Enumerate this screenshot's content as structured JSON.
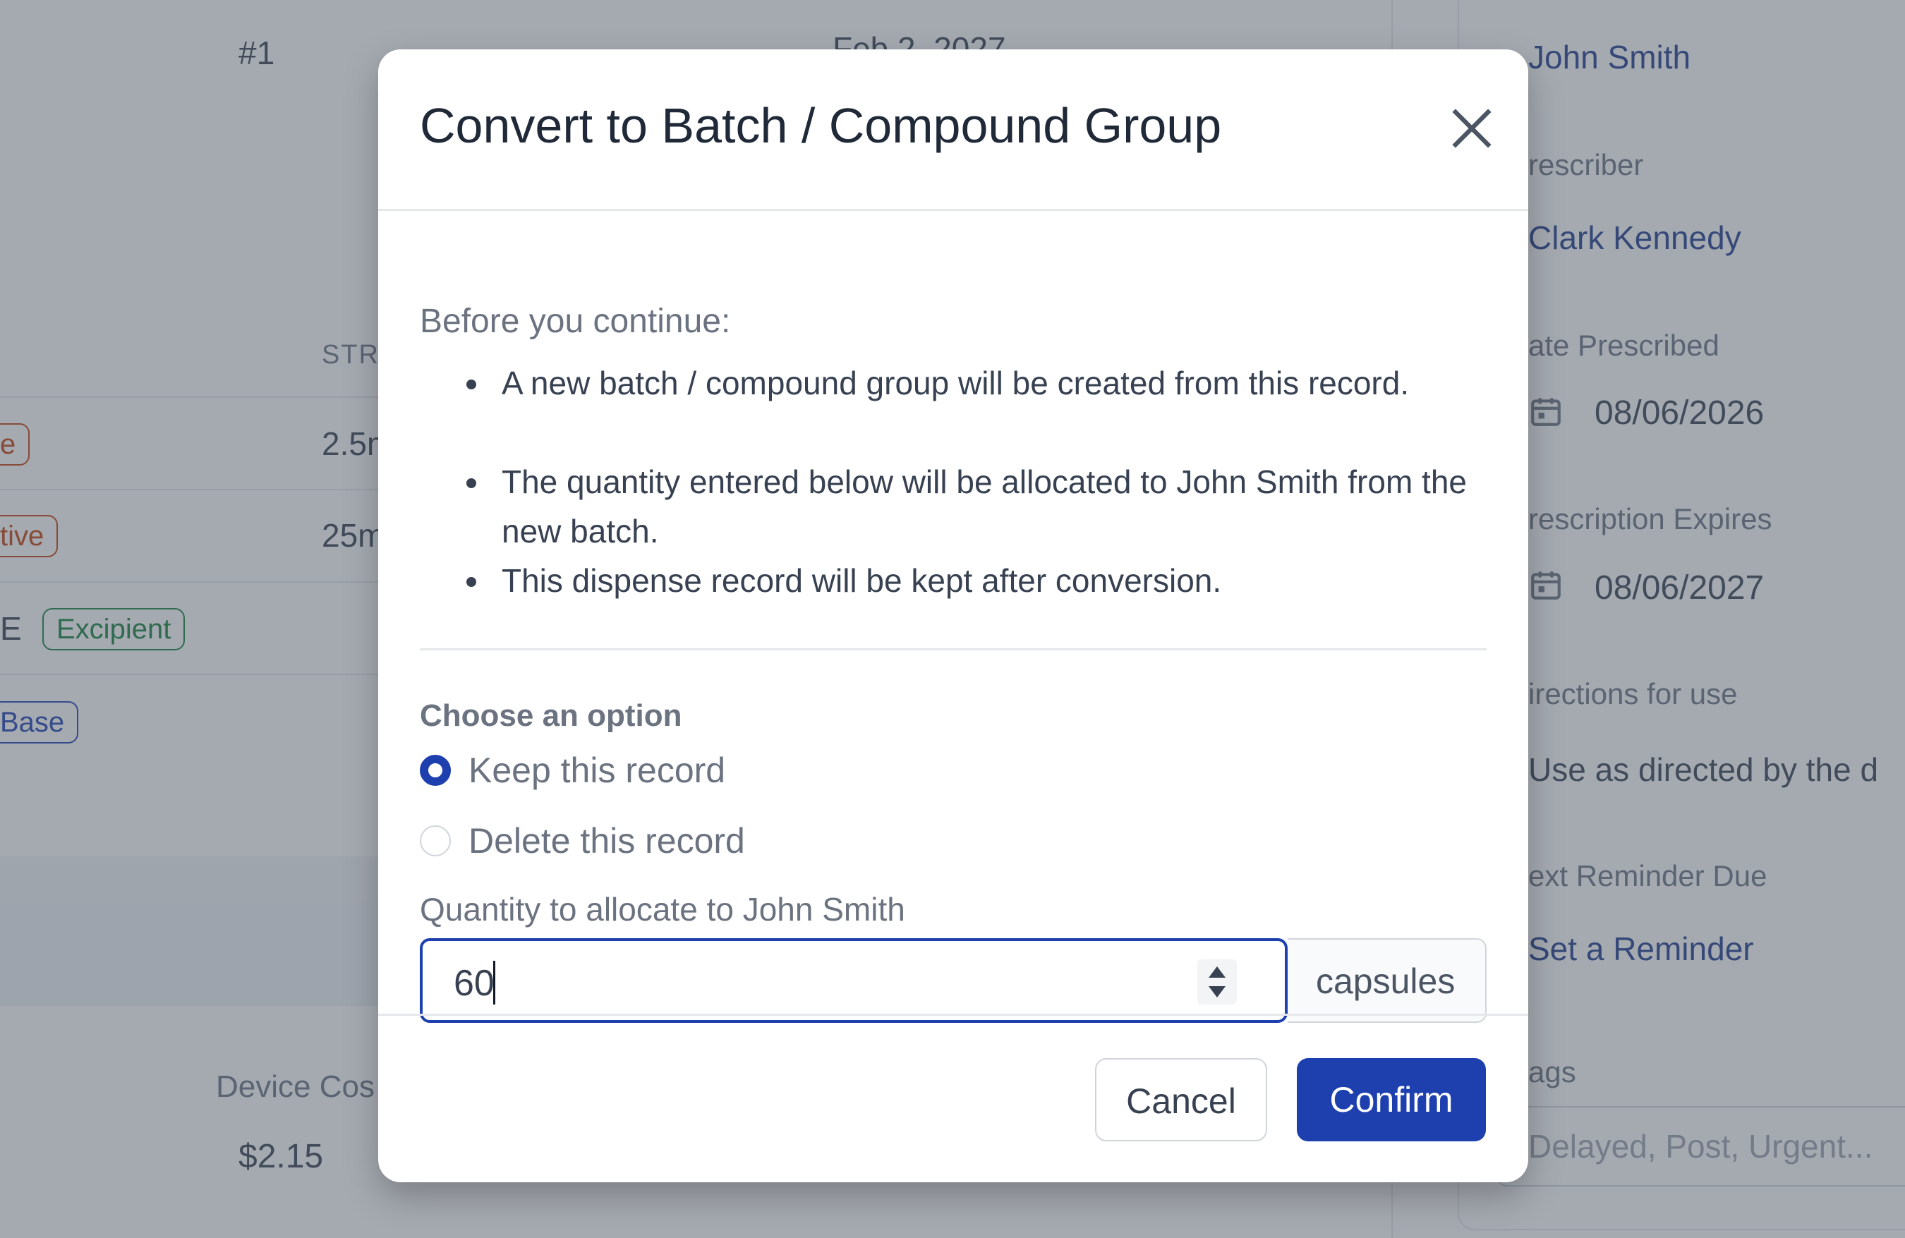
{
  "background": {
    "row_number": "#1",
    "date_partial": "Feb 2, 2027",
    "strength_header": "STR",
    "strength_values": [
      "2.5m",
      "25m"
    ],
    "ingredient_tail": "E",
    "badges": [
      {
        "label": "e",
        "color": "#c2410c"
      },
      {
        "label": "tive",
        "color": "#c2410c"
      },
      {
        "label": "Excipient",
        "color": "#15803d"
      },
      {
        "label": "Base",
        "color": "#1e40af"
      }
    ],
    "device_cost_label": "Device Cos",
    "device_cost_value": "$2.15"
  },
  "sidebar": {
    "patient_name": "John Smith",
    "prescriber_label": "rescriber",
    "prescriber_name": "Clark Kennedy",
    "date_prescribed_label": "ate Prescribed",
    "date_prescribed": "08/06/2026",
    "prescription_expires_label": "rescription Expires",
    "prescription_expires": "08/06/2027",
    "directions_label": "irections for use",
    "directions_value": "Use as directed by the d",
    "next_reminder_label": "ext Reminder Due",
    "set_reminder_link": "Set a Reminder",
    "tags_label": "ags",
    "tags_placeholder": "Delayed, Post, Urgent..."
  },
  "modal": {
    "title": "Convert to Batch / Compound Group",
    "intro": "Before you continue:",
    "bullets": [
      "A new batch / compound group will be created from this record.",
      "The quantity entered below will be allocated to John Smith from the new batch.",
      "This dispense record will be kept after conversion."
    ],
    "option_title": "Choose an option",
    "options": [
      {
        "label": "Keep this record",
        "selected": true
      },
      {
        "label": "Delete this record",
        "selected": false
      }
    ],
    "quantity_label": "Quantity to allocate to John Smith",
    "quantity_value": "60",
    "quantity_unit": "capsules",
    "cancel_label": "Cancel",
    "confirm_label": "Confirm",
    "accent_color": "#1e40af"
  }
}
